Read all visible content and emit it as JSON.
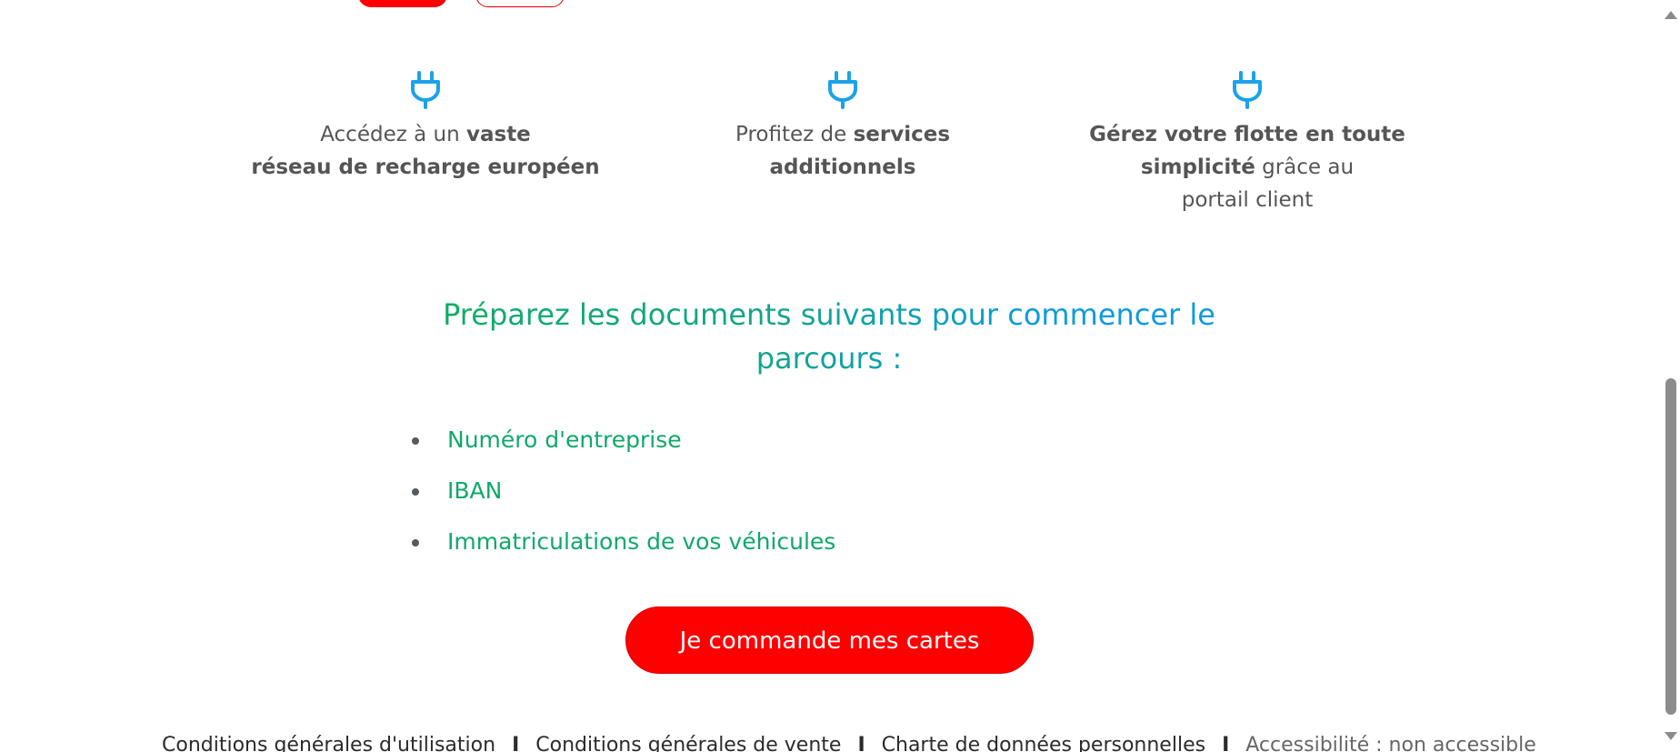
{
  "features": [
    {
      "pre": "Accédez à un ",
      "bold1": "vaste",
      "bold2": "réseau de recharge européen",
      "icon": "plug-icon"
    },
    {
      "pre": "Profitez de ",
      "bold1": "services additionnels",
      "icon": "plug-icon"
    },
    {
      "bold1": "Gérez votre flotte en toute",
      "bold2": "simplicité",
      "post": " grâce au",
      "line3": "portail client",
      "icon": "plug-icon"
    }
  ],
  "heading": {
    "line1": "Préparez les documents suivants pour commencer le",
    "line2": "parcours :"
  },
  "documents": [
    "Numéro d'entreprise",
    "IBAN",
    "Immatriculations de vos véhicules"
  ],
  "cta": {
    "label": "Je commande mes cartes"
  },
  "footer": {
    "links": [
      "Conditions générales d'utilisation",
      "Conditions générales de vente",
      "Charte de données personnelles",
      "Accessibilité : non accessible"
    ],
    "separator": "I"
  },
  "colors": {
    "accent_red": "#ff0000",
    "icon_blue": "#1aa3e8",
    "list_green": "#10a86a"
  }
}
